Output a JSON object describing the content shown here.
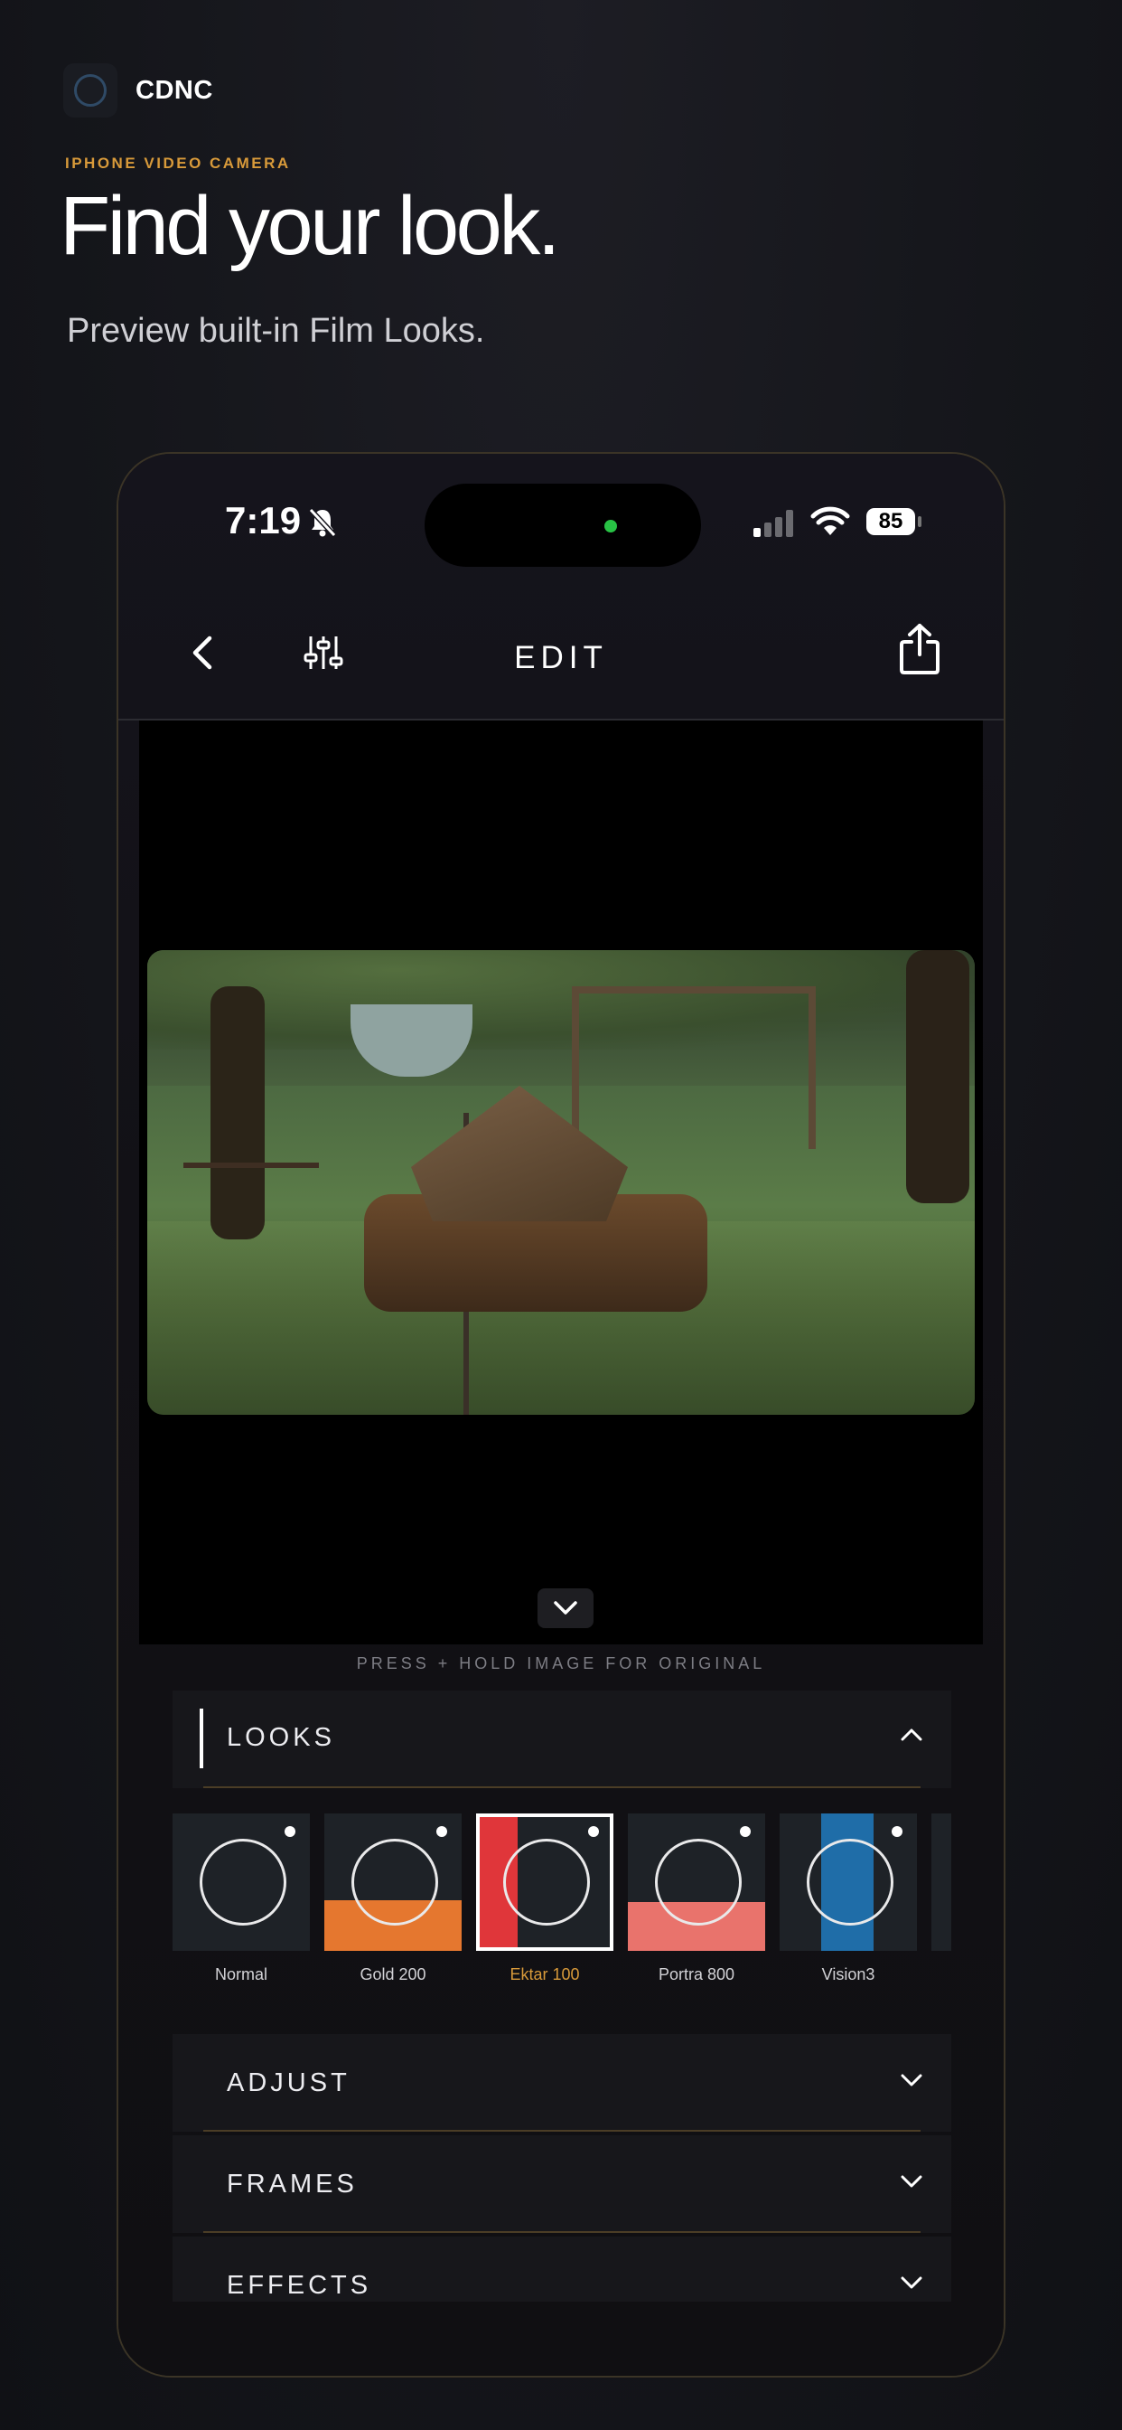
{
  "brand": {
    "name": "CDNC"
  },
  "hero": {
    "eyebrow": "IPHONE VIDEO CAMERA",
    "headline": "Find your look.",
    "subhead": "Preview built-in Film Looks."
  },
  "status_bar": {
    "time": "7:19",
    "battery": "85"
  },
  "nav": {
    "title": "EDIT"
  },
  "viewer": {
    "hint": "PRESS + HOLD IMAGE FOR ORIGINAL"
  },
  "looks": {
    "header": "LOOKS",
    "items": [
      {
        "name": "Normal",
        "swatch": "",
        "selected": false
      },
      {
        "name": "Gold 200",
        "swatch": "#e5772f",
        "selected": false
      },
      {
        "name": "Ektar 100",
        "swatch": "#e0363a",
        "selected": true
      },
      {
        "name": "Portra 800",
        "swatch": "#e9736c",
        "selected": false
      },
      {
        "name": "Vision3",
        "swatch": "#1f6da8",
        "selected": false
      }
    ]
  },
  "sections": [
    {
      "label": "ADJUST"
    },
    {
      "label": "FRAMES"
    },
    {
      "label": "EFFECTS"
    }
  ],
  "colors": {
    "accent": "#d89a3a"
  }
}
